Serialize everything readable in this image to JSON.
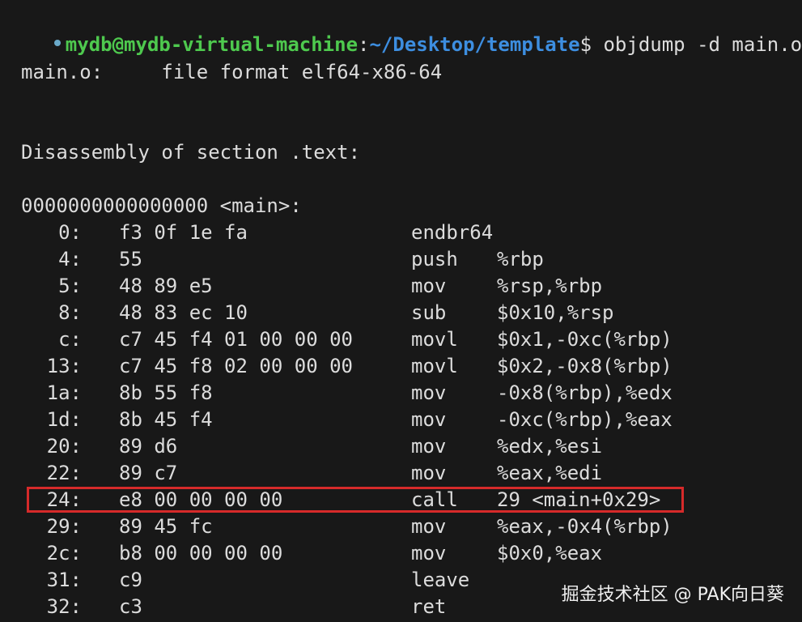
{
  "prompt": {
    "user_host": "mydb@mydb-virtual-machine",
    "separator": ":",
    "path": "~/Desktop/template",
    "symbol": "$",
    "command": " objdump -d main.o"
  },
  "file_header": "main.o:     file format elf64-x86-64",
  "section_header": "Disassembly of section .text:",
  "symbol_header": "0000000000000000 <main>:",
  "rows": [
    {
      "addr": "0:",
      "bytes": "f3 0f 1e fa",
      "mnemonic": "endbr64",
      "operands": ""
    },
    {
      "addr": "4:",
      "bytes": "55",
      "mnemonic": "push",
      "operands": "%rbp"
    },
    {
      "addr": "5:",
      "bytes": "48 89 e5",
      "mnemonic": "mov",
      "operands": "%rsp,%rbp"
    },
    {
      "addr": "8:",
      "bytes": "48 83 ec 10",
      "mnemonic": "sub",
      "operands": "$0x10,%rsp"
    },
    {
      "addr": "c:",
      "bytes": "c7 45 f4 01 00 00 00",
      "mnemonic": "movl",
      "operands": "$0x1,-0xc(%rbp)"
    },
    {
      "addr": "13:",
      "bytes": "c7 45 f8 02 00 00 00",
      "mnemonic": "movl",
      "operands": "$0x2,-0x8(%rbp)"
    },
    {
      "addr": "1a:",
      "bytes": "8b 55 f8",
      "mnemonic": "mov",
      "operands": "-0x8(%rbp),%edx"
    },
    {
      "addr": "1d:",
      "bytes": "8b 45 f4",
      "mnemonic": "mov",
      "operands": "-0xc(%rbp),%eax"
    },
    {
      "addr": "20:",
      "bytes": "89 d6",
      "mnemonic": "mov",
      "operands": "%edx,%esi"
    },
    {
      "addr": "22:",
      "bytes": "89 c7",
      "mnemonic": "mov",
      "operands": "%eax,%edi"
    },
    {
      "addr": "24:",
      "bytes": "e8 00 00 00 00",
      "mnemonic": "call",
      "operands": "29 <main+0x29>"
    },
    {
      "addr": "29:",
      "bytes": "89 45 fc",
      "mnemonic": "mov",
      "operands": "%eax,-0x4(%rbp)"
    },
    {
      "addr": "2c:",
      "bytes": "b8 00 00 00 00",
      "mnemonic": "mov",
      "operands": "$0x0,%eax"
    },
    {
      "addr": "31:",
      "bytes": "c9",
      "mnemonic": "leave",
      "operands": ""
    },
    {
      "addr": "32:",
      "bytes": "c3",
      "mnemonic": "ret",
      "operands": ""
    }
  ],
  "watermark": "掘金技术社区 @ PAK向日葵",
  "colors": {
    "background": "#181818",
    "text": "#dcdcdc",
    "user_host": "#4ec94e",
    "path": "#3d8ee0",
    "highlight_border": "#d62a2a"
  }
}
